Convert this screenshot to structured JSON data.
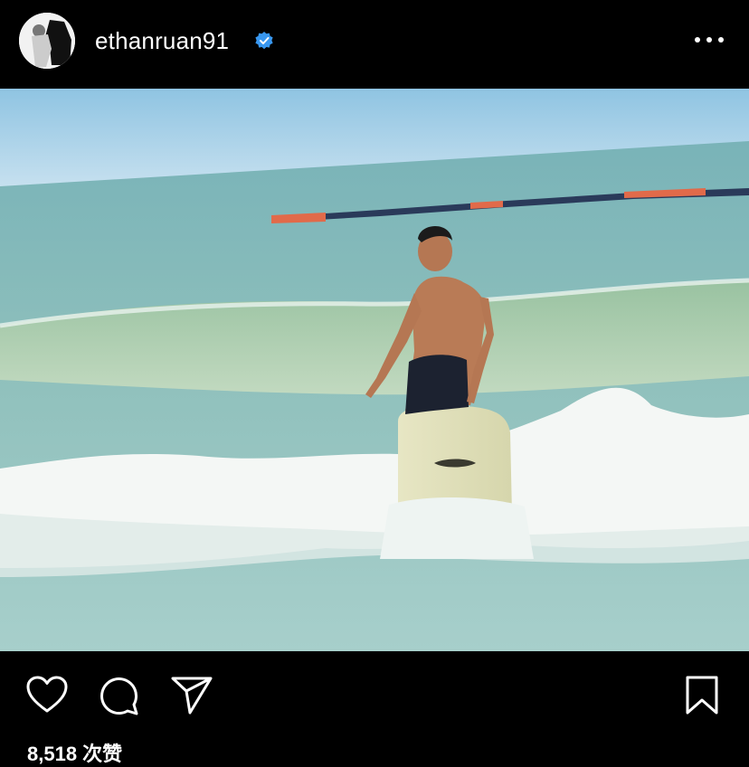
{
  "post": {
    "username": "ethanruan91",
    "verified": true,
    "avatar_icon": "profile-avatar",
    "more_icon": "more-horizontal-icon"
  },
  "photo": {
    "subject": "surfing-photo"
  },
  "actions": {
    "like_icon": "heart-icon",
    "comment_icon": "comment-bubble-icon",
    "share_icon": "send-icon",
    "save_icon": "bookmark-icon"
  },
  "stats": {
    "likes_label": "8,518 次赞"
  },
  "colors": {
    "background": "#000000",
    "verified_blue": "#3897f0",
    "text": "#ffffff"
  }
}
